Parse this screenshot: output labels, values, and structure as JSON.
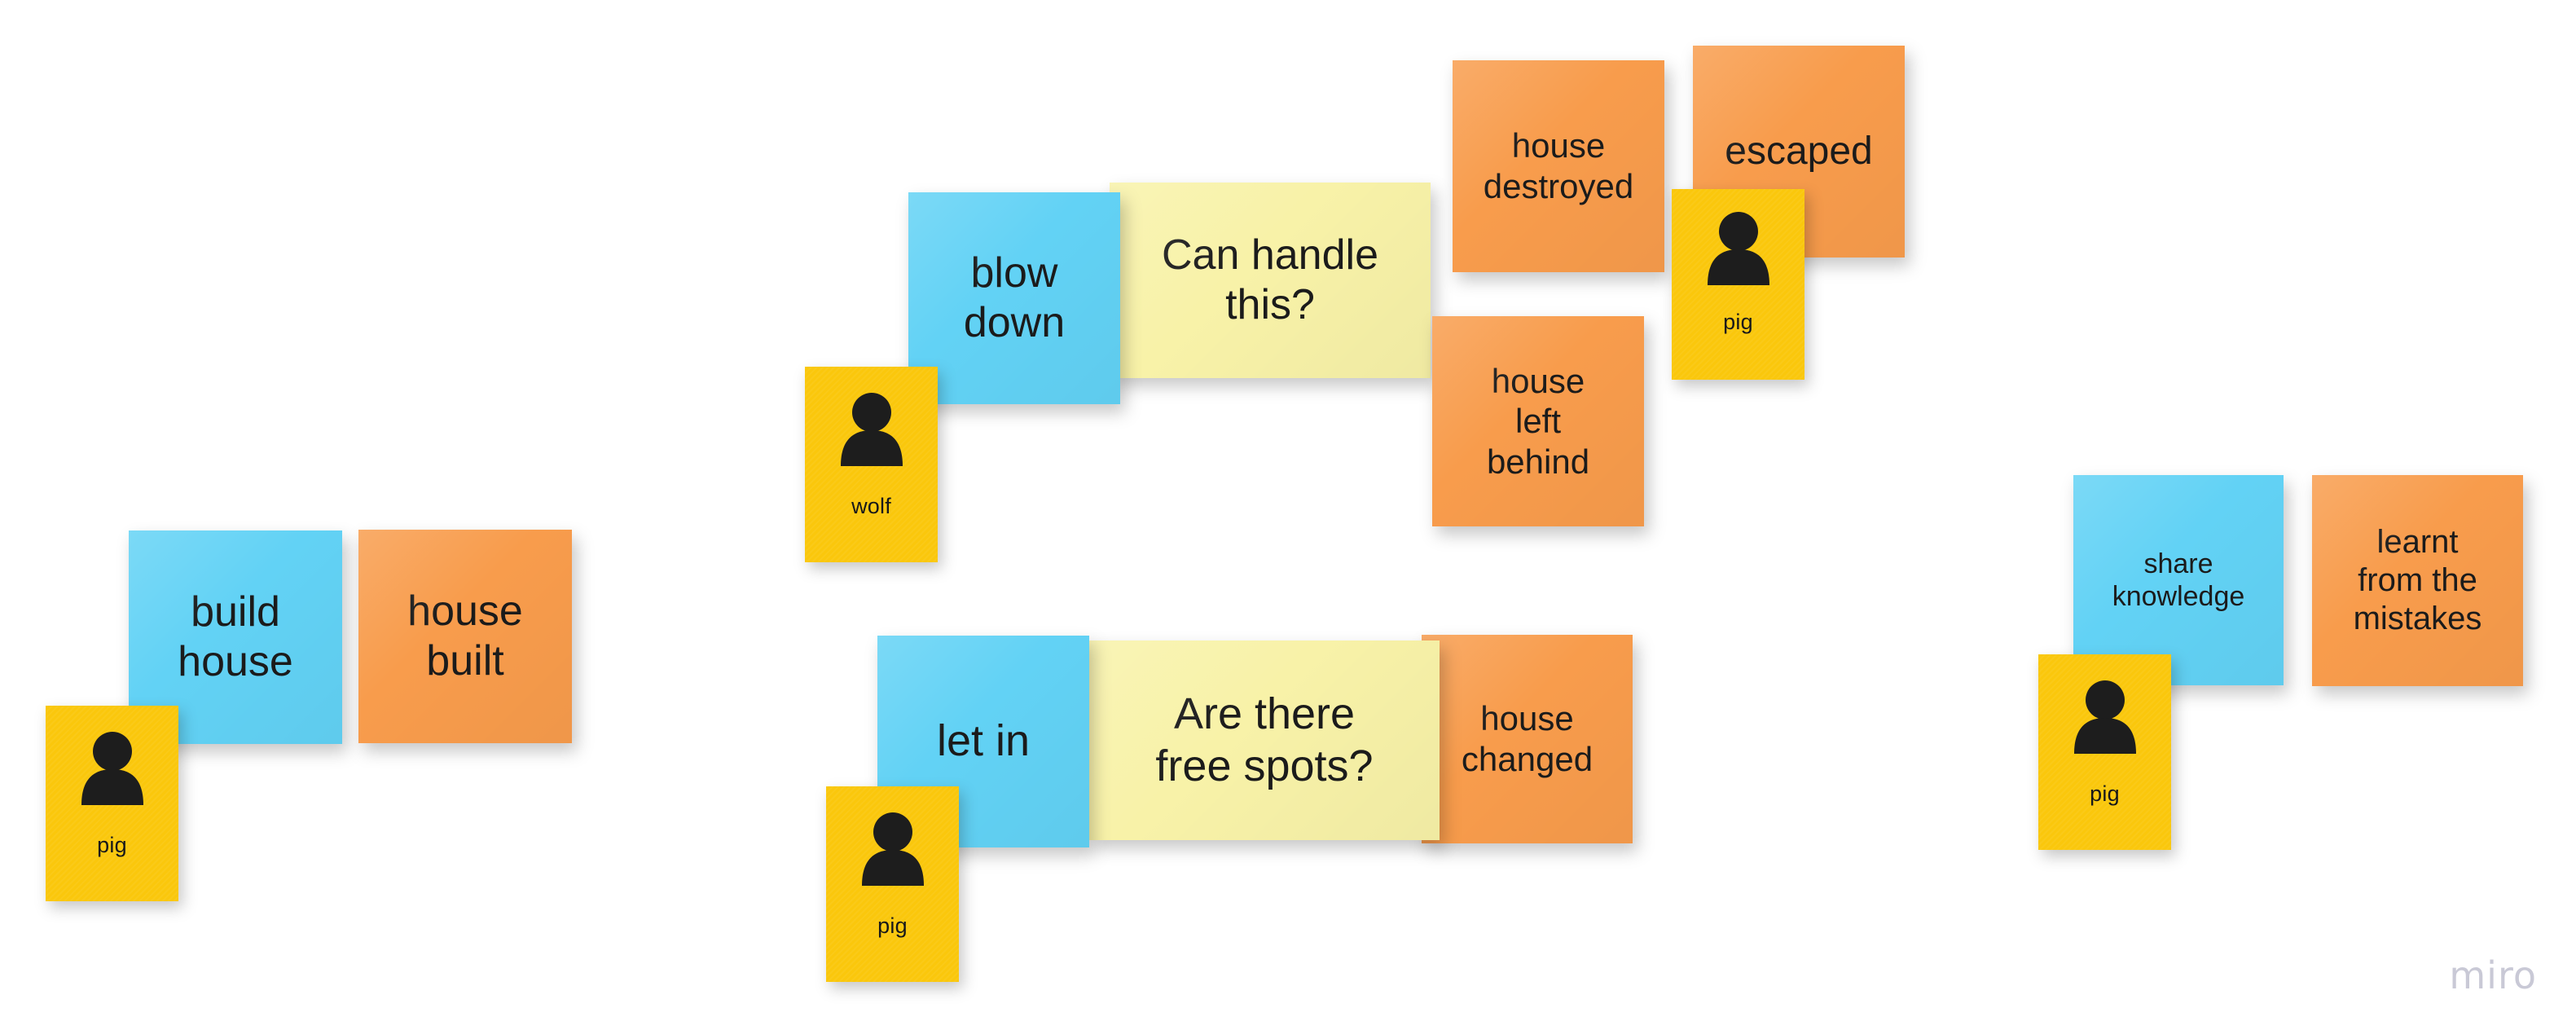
{
  "board": {
    "background_color": "#ffffff",
    "watermark": "miro"
  },
  "palette": {
    "blue": "#62d2f5",
    "orange": "#f89c4c",
    "yellow": "#f8f2a8",
    "actor_yellow": "#fac70c",
    "text": "#1b1b1b",
    "watermark": "#c9c9d6"
  },
  "clusters": [
    {
      "id": "build-house",
      "actor": {
        "name": "pig",
        "icon": "person-avatar-icon"
      },
      "notes": [
        {
          "id": "build-house",
          "kind": "command",
          "color": "blue",
          "text": "build\nhouse"
        },
        {
          "id": "house-built",
          "kind": "event",
          "color": "orange",
          "text": "house\nbuilt"
        }
      ]
    },
    {
      "id": "blow-down",
      "actor": {
        "name": "wolf",
        "icon": "person-avatar-icon"
      },
      "notes": [
        {
          "id": "blow-down",
          "kind": "command",
          "color": "blue",
          "text": "blow\ndown"
        },
        {
          "id": "can-handle-this",
          "kind": "question",
          "color": "yellow",
          "text": "Can handle\nthis?"
        },
        {
          "id": "house-destroyed",
          "kind": "event",
          "color": "orange",
          "text": "house\ndestroyed"
        },
        {
          "id": "house-left-behind",
          "kind": "event",
          "color": "orange",
          "text": "house\nleft\nbehind"
        },
        {
          "id": "escaped",
          "kind": "event",
          "color": "orange",
          "text": "escaped"
        }
      ],
      "secondary_actor": {
        "name": "pig",
        "icon": "person-avatar-icon"
      }
    },
    {
      "id": "let-in",
      "actor": {
        "name": "pig",
        "icon": "person-avatar-icon"
      },
      "notes": [
        {
          "id": "let-in",
          "kind": "command",
          "color": "blue",
          "text": "let in"
        },
        {
          "id": "are-there-free-spots",
          "kind": "question",
          "color": "yellow",
          "text": "Are there\nfree spots?"
        },
        {
          "id": "house-changed",
          "kind": "event",
          "color": "orange",
          "text": "house\nchanged"
        }
      ]
    },
    {
      "id": "share-knowledge",
      "actor": {
        "name": "pig",
        "icon": "person-avatar-icon"
      },
      "notes": [
        {
          "id": "share-knowledge",
          "kind": "command",
          "color": "blue",
          "text": "share\nknowledge"
        },
        {
          "id": "learnt-from-the-mistakes",
          "kind": "event",
          "color": "orange",
          "text": "learnt\nfrom the\nmistakes"
        }
      ]
    }
  ]
}
